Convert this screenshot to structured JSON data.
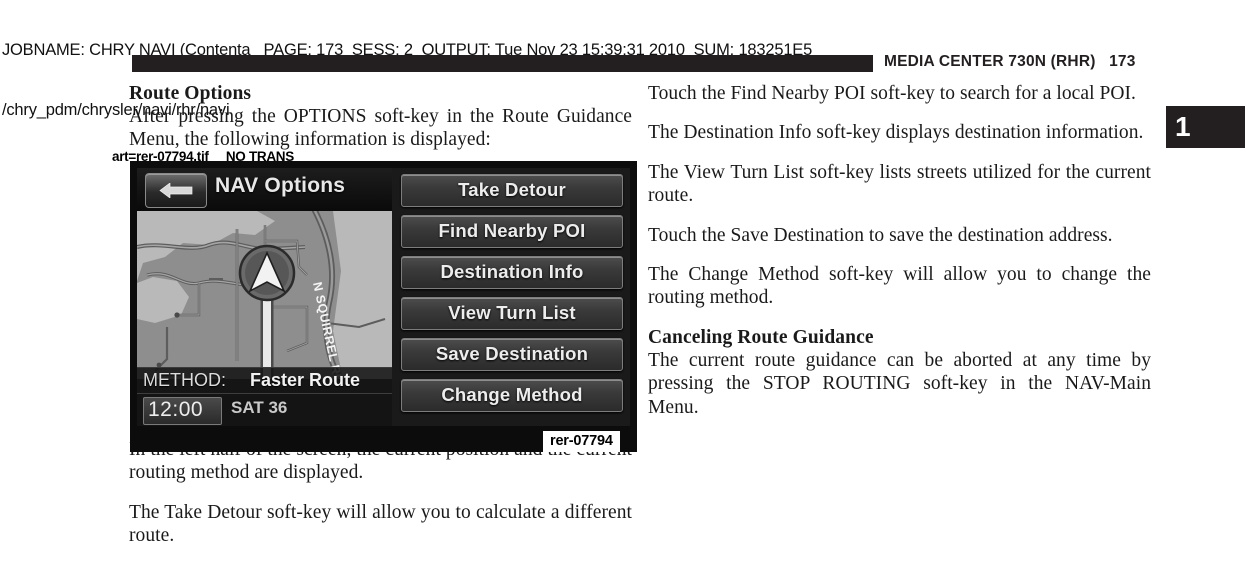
{
  "job_slug": {
    "line1": "JOBNAME: CHRY NAVI (Contenta   PAGE: 173  SESS: 2  OUTPUT: Tue Nov 23 15:39:31 2010  SUM: 183251E5",
    "line2": "/chry_pdm/chrysler/navi/rhr/navi"
  },
  "running_head": {
    "title": "MEDIA CENTER 730N (RHR)   173"
  },
  "chapter_tab": {
    "number": "1"
  },
  "art_annotation": {
    "text": "art=rer-07794.tif     NO TRANS"
  },
  "left_column": {
    "heading": "Route Options",
    "paragraph_1": "After pressing the OPTIONS soft-key in the Route Guidance Menu, the following information is displayed:",
    "paragraph_2": "In the left half of the screen, the current position and the current routing method are displayed.",
    "paragraph_3": "The Take Detour soft-key will allow you to calculate a different route."
  },
  "right_column": {
    "paragraph_1": "Touch the Find Nearby POI soft-key to search for a local POI.",
    "paragraph_2": "The Destination Info soft-key displays destination information.",
    "paragraph_3": "The View Turn List soft-key lists streets utilized for the current route.",
    "paragraph_4": "Touch the Save Destination to save the destination address.",
    "paragraph_5": "The Change Method soft-key will allow you to change the routing method.",
    "heading_2": "Canceling Route Guidance",
    "paragraph_6": "The current route guidance can be aborted at any time by pressing the STOP ROUTING soft-key in the NAV-Main Menu."
  },
  "figure": {
    "art_id": "rer-07794",
    "nav_screen": {
      "title": "NAV Options",
      "back_icon": "back-arrow-icon",
      "map": {
        "street_label": "N SQUIRREL RD",
        "vehicle_icon": "vehicle-position-arrow-icon"
      },
      "method_label": "METHOD:",
      "method_value": "Faster Route",
      "clock": "12:00",
      "satellite_status": "SAT 36",
      "soft_keys": [
        {
          "label": "Take Detour"
        },
        {
          "label": "Find Nearby POI"
        },
        {
          "label": "Destination Info"
        },
        {
          "label": "View Turn List"
        },
        {
          "label": "Save Destination"
        },
        {
          "label": "Change Method"
        }
      ]
    }
  },
  "colors": {
    "ink": "#231f20",
    "page": "#ffffff",
    "screen_bg": "#111111",
    "map_land": "#8e8e8e",
    "map_water": "#b9b9b9"
  }
}
